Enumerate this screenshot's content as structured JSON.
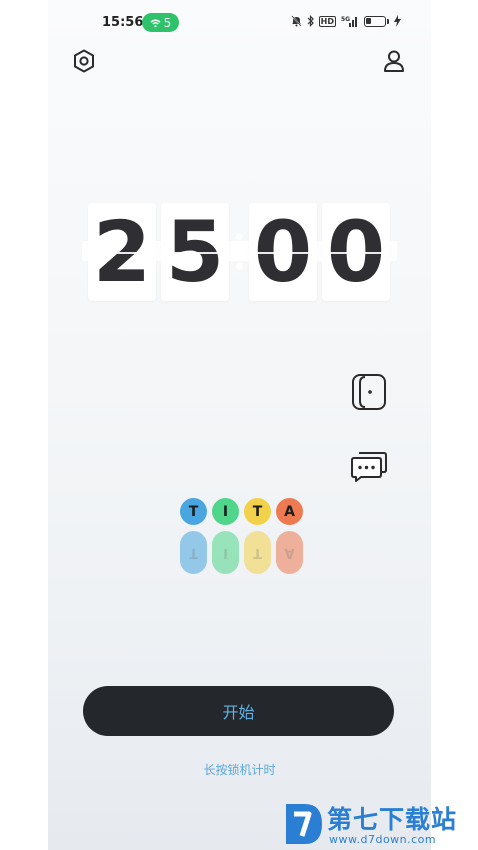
{
  "status_bar": {
    "time": "15:56",
    "wifi_badge": "5",
    "hd_label": "HD",
    "signal_label": "5G",
    "wifi_badge_color": "#2fc26b"
  },
  "icons": {
    "settings": "gear-hex-icon",
    "profile": "person-icon",
    "phone_lock": "phone-lock-icon",
    "chat": "chat-bubbles-icon"
  },
  "clock": {
    "digits": [
      "2",
      "5",
      "0",
      "0"
    ],
    "separator": ":"
  },
  "logo": {
    "letters": [
      {
        "char": "T",
        "color": "#4aa6e0"
      },
      {
        "char": "I",
        "color": "#4fd68a"
      },
      {
        "char": "T",
        "color": "#f2d24a"
      },
      {
        "char": "A",
        "color": "#ee7a52"
      }
    ]
  },
  "actions": {
    "start_label": "开始",
    "lock_hint": "长按锁机计时",
    "start_text_color": "#5eb2e8"
  },
  "watermark": {
    "title": "第七下载站",
    "url": "www.d7down.com"
  }
}
